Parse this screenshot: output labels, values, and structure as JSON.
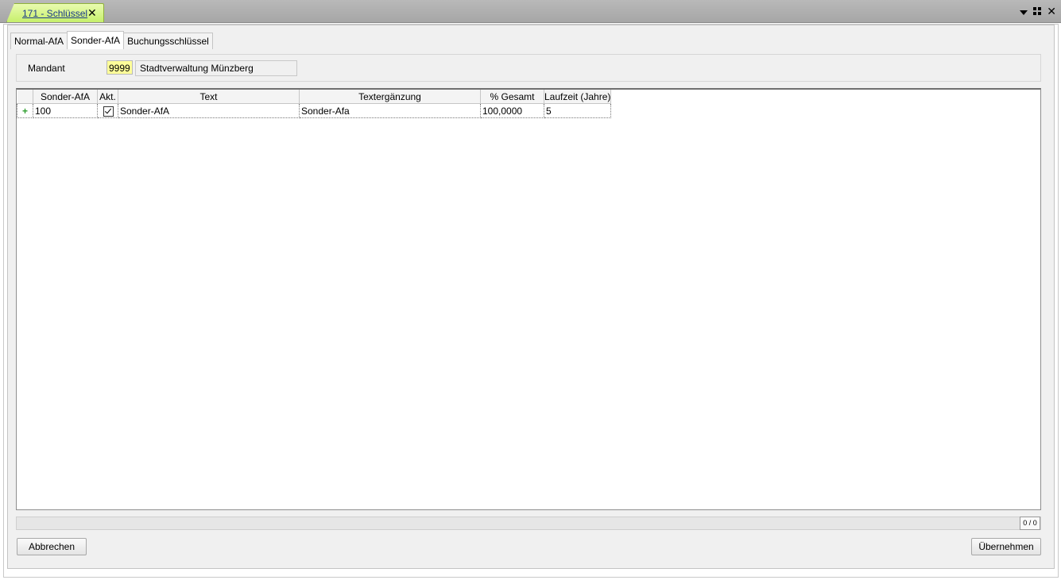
{
  "document_tab": {
    "label": "171 - Schlüssel",
    "close": "✕"
  },
  "window_controls": {
    "close": "✕"
  },
  "tabs": [
    {
      "label": "Normal-AfA",
      "active": false
    },
    {
      "label": "Sonder-AfA",
      "active": true
    },
    {
      "label": "Buchungsschlüssel",
      "active": false
    }
  ],
  "mandant": {
    "label": "Mandant",
    "code": "9999",
    "name": "Stadtverwaltung Münzberg"
  },
  "grid": {
    "columns": [
      "Sonder-AfA",
      "Akt.",
      "Text",
      "Textergänzung",
      "% Gesamt",
      "Laufzeit (Jahre)"
    ],
    "rows": [
      {
        "indicator": "+",
        "sonder_afa": "100",
        "aktiv": true,
        "text": "Sonder-AfA",
        "textergaenzung": "Sonder-Afa",
        "prozent_gesamt": "100,0000",
        "laufzeit": "5"
      }
    ]
  },
  "status": {
    "record_count": "0 / 0"
  },
  "buttons": {
    "cancel": "Abbrechen",
    "apply": "Übernehmen"
  },
  "colors": {
    "tab_accent": "#c6ef6a",
    "mandant_code_bg": "#ffff99",
    "row_indicator": "#2e9e2e"
  }
}
